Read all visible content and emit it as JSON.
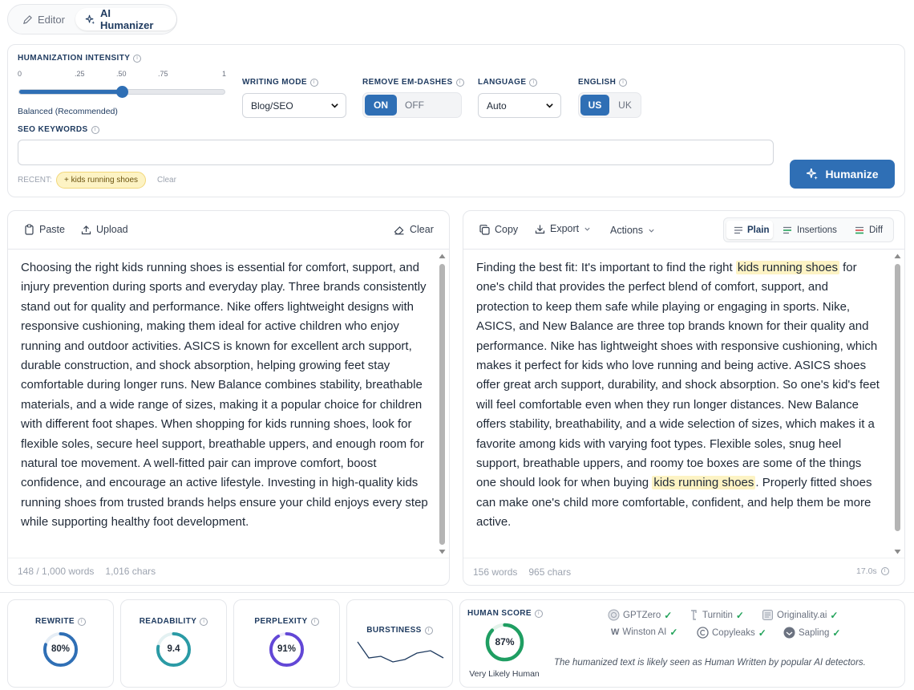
{
  "tabs": [
    {
      "label": "Editor",
      "active": false
    },
    {
      "label": "AI Humanizer",
      "active": true
    }
  ],
  "settings": {
    "intensity_label": "HUMANIZATION INTENSITY",
    "intensity_ticks": [
      "0",
      ".25",
      ".50",
      ".75",
      "1"
    ],
    "intensity_value": 0.5,
    "intensity_caption": "Balanced (Recommended)",
    "writing_mode_label": "WRITING MODE",
    "writing_mode_value": "Blog/SEO",
    "em_dash_label": "REMOVE EM-DASHES",
    "em_dash_on": "ON",
    "em_dash_off": "OFF",
    "language_label": "LANGUAGE",
    "language_value": "Auto",
    "english_label": "ENGLISH",
    "english_us": "US",
    "english_uk": "UK",
    "seo_label": "SEO KEYWORDS",
    "seo_value": "",
    "recent_label": "RECENT:",
    "recent_chip": "+ kids running shoes",
    "recent_clear": "Clear",
    "humanize_button": "Humanize"
  },
  "input_panel": {
    "paste": "Paste",
    "upload": "Upload",
    "clear": "Clear",
    "text": "Choosing the right kids running shoes is essential for comfort, support, and injury prevention during sports and everyday play. Three brands consistently stand out for quality and performance. Nike offers lightweight designs with responsive cushioning, making them ideal for active children who enjoy running and outdoor activities. ASICS is known for excellent arch support, durable construction, and shock absorption, helping growing feet stay comfortable during longer runs. New Balance combines stability, breathable materials, and a wide range of sizes, making it a popular choice for children with different foot shapes. When shopping for kids running shoes, look for flexible soles, secure heel support, breathable uppers, and enough room for natural toe movement. A well-fitted pair can improve comfort, boost confidence, and encourage an active lifestyle. Investing in high-quality kids running shoes from trusted brands helps ensure your child enjoys every step while supporting healthy foot development.",
    "words": "148 / 1,000 words",
    "chars": "1,016 chars"
  },
  "output_panel": {
    "copy": "Copy",
    "export": "Export",
    "actions": "Actions",
    "view_plain": "Plain",
    "view_insertions": "Insertions",
    "view_diff": "Diff",
    "text_part1": "Finding the best fit: It's important to find the right",
    "keyword": "kids running shoes",
    "text_part2": "for one's child that provides the perfect blend of comfort, support, and protection to keep them safe while playing or engaging in sports. Nike, ASICS, and New Balance are three top brands known for their quality and performance. Nike has lightweight shoes with responsive cushioning, which makes it perfect for kids who love running and being active. ASICS shoes offer great arch support, durability, and shock absorption. So one's kid's feet will feel comfortable even when they run longer distances. New Balance offers stability, breathability, and a wide selection of sizes, which makes it a favorite among kids with varying foot types. Flexible soles, snug heel support, breathable uppers, and roomy toe boxes are some of the things one should look for when buying",
    "text_part3": ". Properly fitted shoes can make one's child more comfortable, confident, and help them be more active.",
    "words": "156 words",
    "chars": "965 chars",
    "time": "17.0s"
  },
  "metrics": {
    "rewrite_label": "REWRITE",
    "rewrite_value": "80%",
    "rewrite_fraction": 0.8,
    "readability_label": "READABILITY",
    "readability_value": "9.4",
    "readability_fraction": 0.78,
    "perplexity_label": "PERPLEXITY",
    "perplexity_value": "91%",
    "perplexity_fraction": 0.91,
    "burstiness_label": "BURSTINESS",
    "human_label": "HUMAN SCORE",
    "human_value": "87%",
    "human_fraction": 0.87,
    "human_caption": "Very Likely Human",
    "detectors": [
      "GPTZero",
      "Turnitin",
      "Originality.ai",
      "Winston AI",
      "Copyleaks",
      "Sapling"
    ],
    "detector_note": "The humanized text is likely seen as Human Written by popular AI detectors."
  },
  "colors": {
    "accent": "#2f6fb5",
    "rewrite": "#2f6fb5",
    "readability": "#2a9aa5",
    "perplexity": "#6247d6",
    "human": "#1f9e62",
    "highlight": "#fdf3c4"
  }
}
